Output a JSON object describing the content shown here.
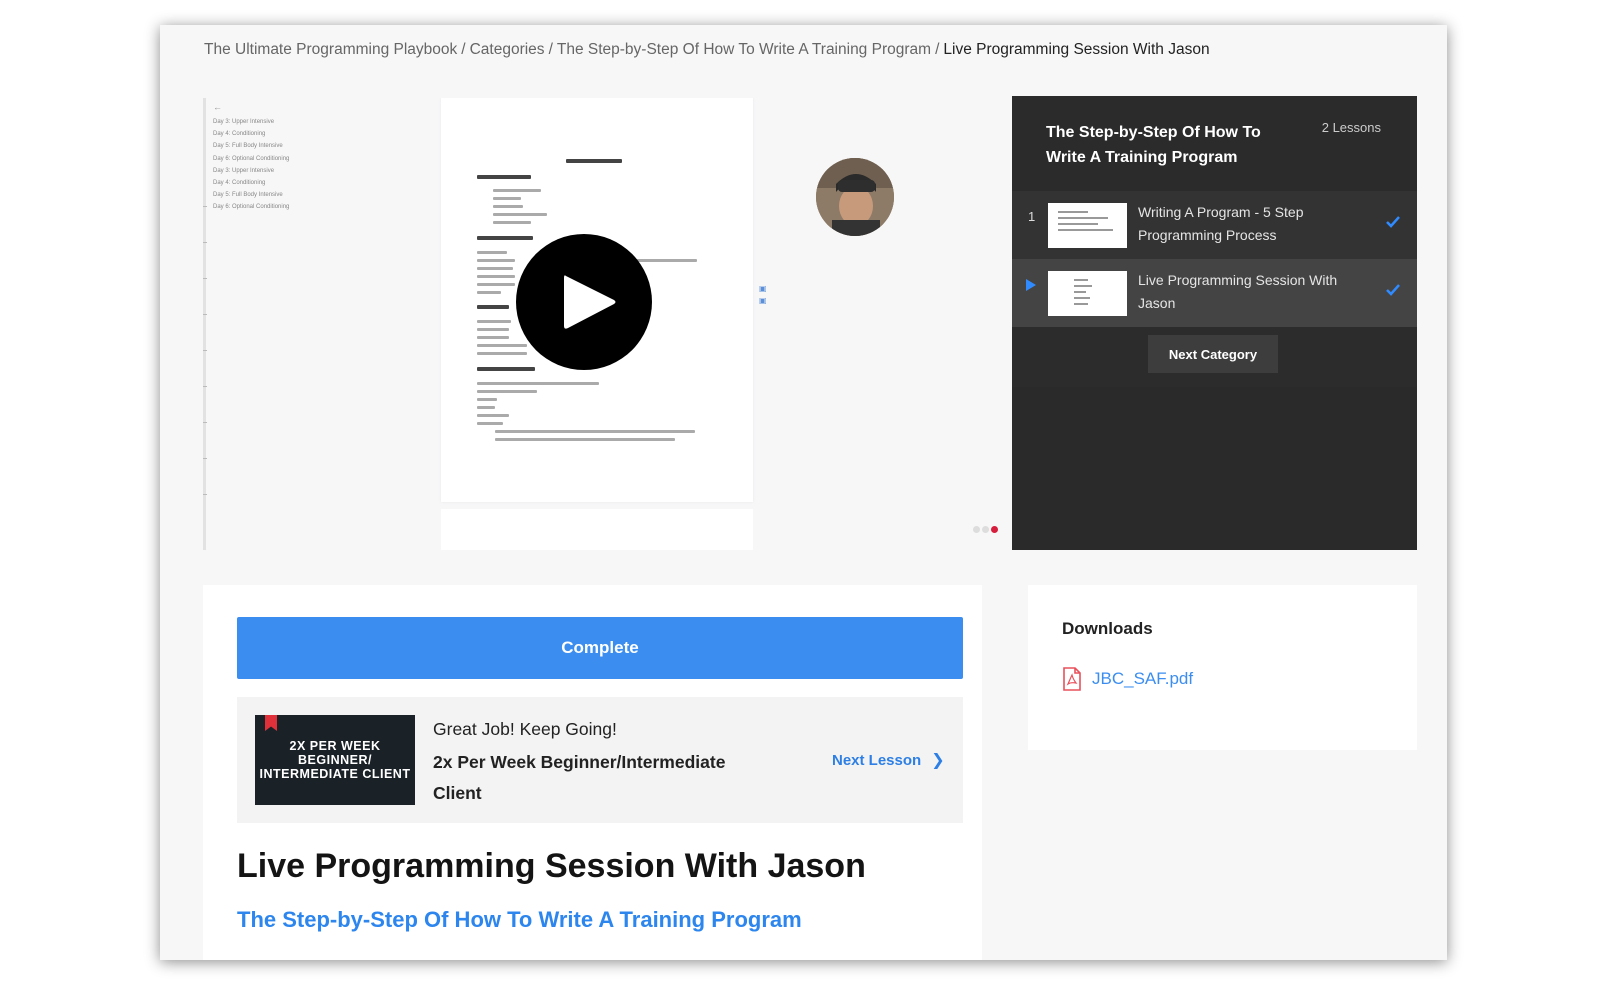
{
  "breadcrumb": {
    "items": [
      "The Ultimate Programming Playbook",
      "Categories",
      "The Step-by-Step Of How To Write A Training Program"
    ],
    "current": "Live Programming Session With Jason",
    "separator": "/"
  },
  "video": {
    "outline": [
      "Day 3: Upper Intensive",
      "Day 4: Conditioning",
      "Day 5: Full Body Intensive",
      "Day 6: Optional Conditioning",
      "Day 3: Upper Intensive",
      "Day 4: Conditioning",
      "Day 5: Full Body Intensive",
      "Day 6: Optional Conditioning"
    ],
    "play_icon": "play-icon"
  },
  "panel": {
    "title": "The Step-by-Step Of How To Write A Training Program",
    "count": "2 Lessons",
    "lessons": [
      {
        "num": "1",
        "title": "Writing A Program - 5 Step Programming Process",
        "completed": true
      },
      {
        "num": "",
        "title": "Live Programming Session With Jason",
        "completed": true,
        "active": true
      }
    ],
    "next_category": "Next Category"
  },
  "main": {
    "complete_label": "Complete",
    "next": {
      "thumb_text": "2X PER WEEK BEGINNER/ INTERMEDIATE CLIENT",
      "kicker": "Great Job! Keep Going!",
      "title": "2x Per Week Beginner/Intermediate Client",
      "link": "Next Lesson"
    },
    "title": "Live Programming Session With Jason",
    "category_link": "The Step-by-Step Of How To Write A Training Program"
  },
  "downloads": {
    "title": "Downloads",
    "file": "JBC_SAF.pdf"
  },
  "colors": {
    "accent": "#3b8ef0",
    "panel_bg": "#2a2a2a",
    "check": "#2f8bff"
  }
}
